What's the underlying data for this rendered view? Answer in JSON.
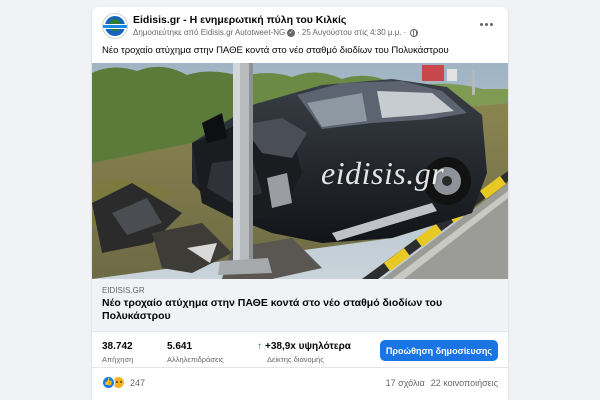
{
  "post": {
    "page_name": "Eidisis.gr - Η ενημερωτική πύλη του Κιλκίς",
    "shared_by": "Δημοσιεύτηκε από Eidisis.gr Autotweet-NG",
    "verified_mark": "✓",
    "separator": "·",
    "timestamp": "25 Αυγούστου στις 4:30 μ.μ.",
    "text": "Νέο τροχαίο ατύχημα στην ΠΑΘΕ κοντά στο νέο σταθμό διοδίων του Πολυκάστρου",
    "icons": {
      "avatar": "eidisis-logo",
      "menu": "more-options-icon",
      "audience": "globe-icon"
    }
  },
  "photo": {
    "watermark": "eidisis.gr",
    "description_icons": [
      "crashed-suv",
      "street-light-pole",
      "road-curb"
    ]
  },
  "link": {
    "domain": "EIDISIS.GR",
    "title": "Νέο τροχαίο ατύχημα στην ΠΑΘΕ κοντά στο νέο σταθμό διοδίων του Πολυκάστρου"
  },
  "stats": {
    "reach_value": "38.742",
    "reach_label": "Απήχηση",
    "engagements_value": "5.641",
    "engagements_label": "Αλληλεπιδράσεις",
    "distribution_arrow": "↑",
    "distribution_value": "+38,9x υψηλότερα",
    "distribution_label": "Δείκτης διανομής",
    "promote_button": "Προώθηση δημοσίευσης"
  },
  "footer": {
    "reaction_icons": [
      "like-icon",
      "sad-icon"
    ],
    "reaction_count": "247",
    "comments": "17 σχόλια",
    "shares": "22 κοινοποιήσεις"
  },
  "colors": {
    "accent": "#1b74e4",
    "positive": "#2e7d32",
    "secondary_text": "#65676b"
  }
}
